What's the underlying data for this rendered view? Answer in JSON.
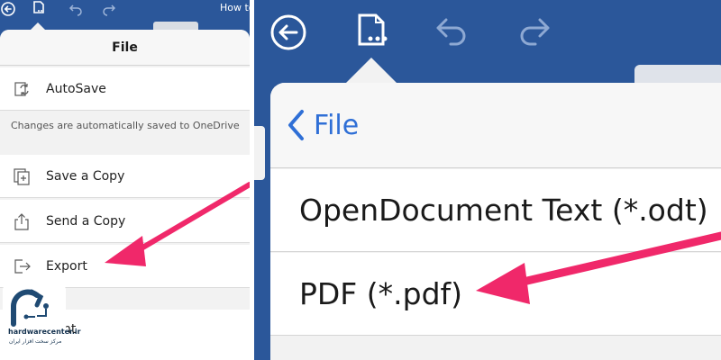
{
  "left": {
    "title": "File",
    "doc_title": "How to",
    "rows": [
      {
        "label": "AutoSave",
        "icon": "autosave-icon"
      },
      {
        "label": "Save a Copy",
        "icon": "save-copy-icon"
      },
      {
        "label": "Send a Copy",
        "icon": "share-icon"
      },
      {
        "label": "Export",
        "icon": "export-icon"
      }
    ],
    "autosave_note": "Changes are automatically saved to OneDrive",
    "cut_label": "nt"
  },
  "right": {
    "title": "File",
    "options": [
      {
        "label": "OpenDocument Text (*.odt)"
      },
      {
        "label": "PDF (*.pdf)"
      }
    ]
  },
  "watermark": {
    "site": "hardwarecenter.ir",
    "tagline": "مرکز سخت افزار ایران"
  },
  "colors": {
    "toolbar_blue": "#2b579a",
    "accent_blue": "#2f6fd6",
    "arrow_pink": "#f0286a"
  }
}
